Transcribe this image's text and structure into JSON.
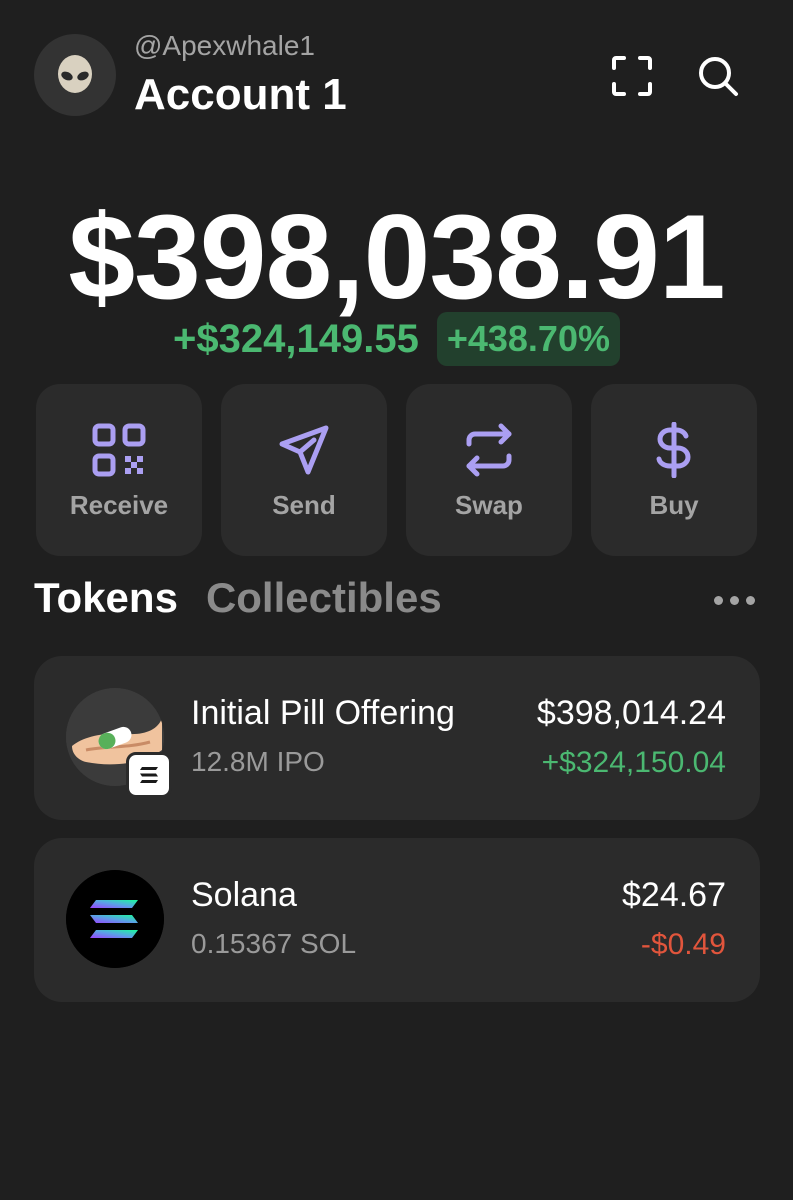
{
  "header": {
    "handle": "@Apexwhale1",
    "account_name": "Account 1",
    "avatar_icon": "alien-icon",
    "scan_icon": "scan-icon",
    "search_icon": "search-icon"
  },
  "portfolio": {
    "balance": "$398,038.91",
    "change_amount": "+$324,149.55",
    "change_percent": "+438.70%"
  },
  "actions": [
    {
      "label": "Receive",
      "icon": "qr-code-icon"
    },
    {
      "label": "Send",
      "icon": "send-arrow-icon"
    },
    {
      "label": "Swap",
      "icon": "swap-icon"
    },
    {
      "label": "Buy",
      "icon": "dollar-icon"
    }
  ],
  "tabs": [
    {
      "label": "Tokens",
      "active": true
    },
    {
      "label": "Collectibles",
      "active": false
    }
  ],
  "more_icon": "more-dots-icon",
  "tokens": [
    {
      "name": "Initial Pill Offering",
      "amount": "12.8M IPO",
      "value": "$398,014.24",
      "change": "+$324,150.04",
      "change_direction": "positive",
      "logo_icon": "pill-hand-icon",
      "badge_icon": "solana-badge-icon"
    },
    {
      "name": "Solana",
      "amount": "0.15367 SOL",
      "value": "$24.67",
      "change": "-$0.49",
      "change_direction": "negative",
      "logo_icon": "solana-icon"
    }
  ],
  "colors": {
    "background": "#1f1f1f",
    "card": "#2b2b2b",
    "accent_purple": "#ab9ff2",
    "positive": "#4bb871",
    "negative": "#e1553c"
  }
}
